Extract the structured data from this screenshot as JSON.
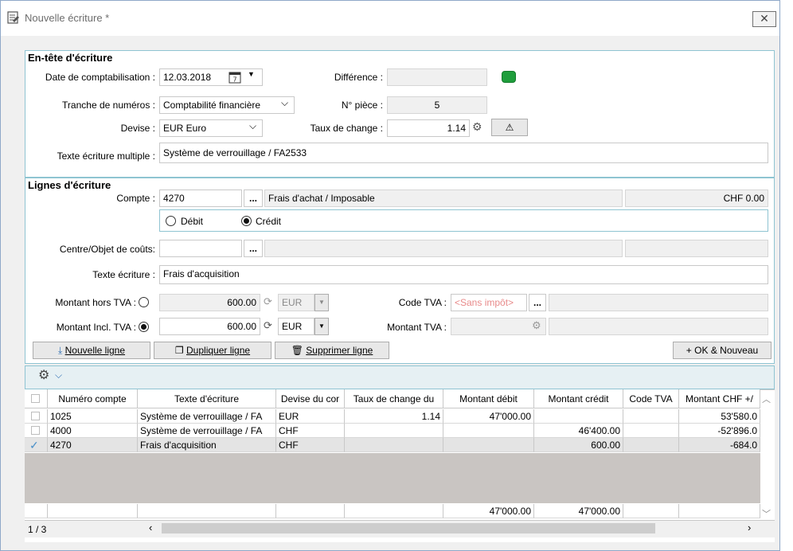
{
  "window": {
    "title": "Nouvelle écriture *",
    "close": "✕"
  },
  "header_group": {
    "title": "En-tête d'écriture",
    "date_label": "Date de comptabilisation :",
    "date_value": "12.03.2018",
    "difference_label": "Différence :",
    "difference_value": "",
    "tranche_label": "Tranche de numéros :",
    "tranche_value": "Comptabilité financière",
    "piece_label": "N° pièce :",
    "piece_value": "5",
    "devise_label": "Devise :",
    "devise_value": "EUR Euro",
    "taux_label": "Taux de change :",
    "taux_value": "1.14",
    "texte_multiple_label": "Texte écriture multiple :",
    "texte_multiple_value": "Système de verrouillage / FA2533"
  },
  "lines_group": {
    "title": "Lignes d'écriture",
    "compte_label": "Compte :",
    "compte_value": "4270",
    "compte_desc": "Frais d'achat / Imposable",
    "compte_balance": "CHF 0.00",
    "debit_label": "Débit",
    "credit_label": "Crédit",
    "centre_label": "Centre/Objet de coûts:",
    "centre_value": "",
    "texte_label": "Texte écriture :",
    "texte_value": "Frais d'acquisition",
    "ht_label": "Montant hors TVA :",
    "ht_value": "600.00",
    "ht_currency": "EUR",
    "incl_label": "Montant Incl. TVA :",
    "incl_value": "600.00",
    "incl_currency": "EUR",
    "code_tva_label": "Code TVA :",
    "code_tva_value": "<Sans impôt>",
    "montant_tva_label": "Montant TVA :",
    "montant_tva_value": "",
    "more": "..."
  },
  "buttons": {
    "new_line": "Nouvelle ligne",
    "dup_line": "Dupliquer ligne",
    "del_line": "Supprimer ligne",
    "ok_new": "OK & Nouveau"
  },
  "table": {
    "columns": [
      "Numéro compte",
      "Texte d'écriture",
      "Devise du cor",
      "Taux de change du",
      "Montant débit",
      "Montant crédit",
      "Code TVA",
      "Montant CHF +/"
    ],
    "rows": [
      {
        "compte": "1025",
        "texte": "Système de verrouillage / FA",
        "devise": "EUR",
        "taux": "1.14",
        "debit": "47'000.00",
        "credit": "",
        "code": "",
        "chf": "53'580.0"
      },
      {
        "compte": "4000",
        "texte": "Système de verrouillage / FA",
        "devise": "CHF",
        "taux": "",
        "debit": "",
        "credit": "46'400.00",
        "code": "",
        "chf": "-52'896.0"
      },
      {
        "compte": "4270",
        "texte": "Frais d'acquisition",
        "devise": "CHF",
        "taux": "",
        "debit": "",
        "credit": "600.00",
        "code": "",
        "chf": "-684.0"
      }
    ],
    "totals": {
      "debit": "47'000.00",
      "credit": "47'000.00"
    },
    "pager": "1 / 3"
  },
  "colors": {
    "accent": "#8fc4d2",
    "status_ok": "#1f9e3c"
  }
}
